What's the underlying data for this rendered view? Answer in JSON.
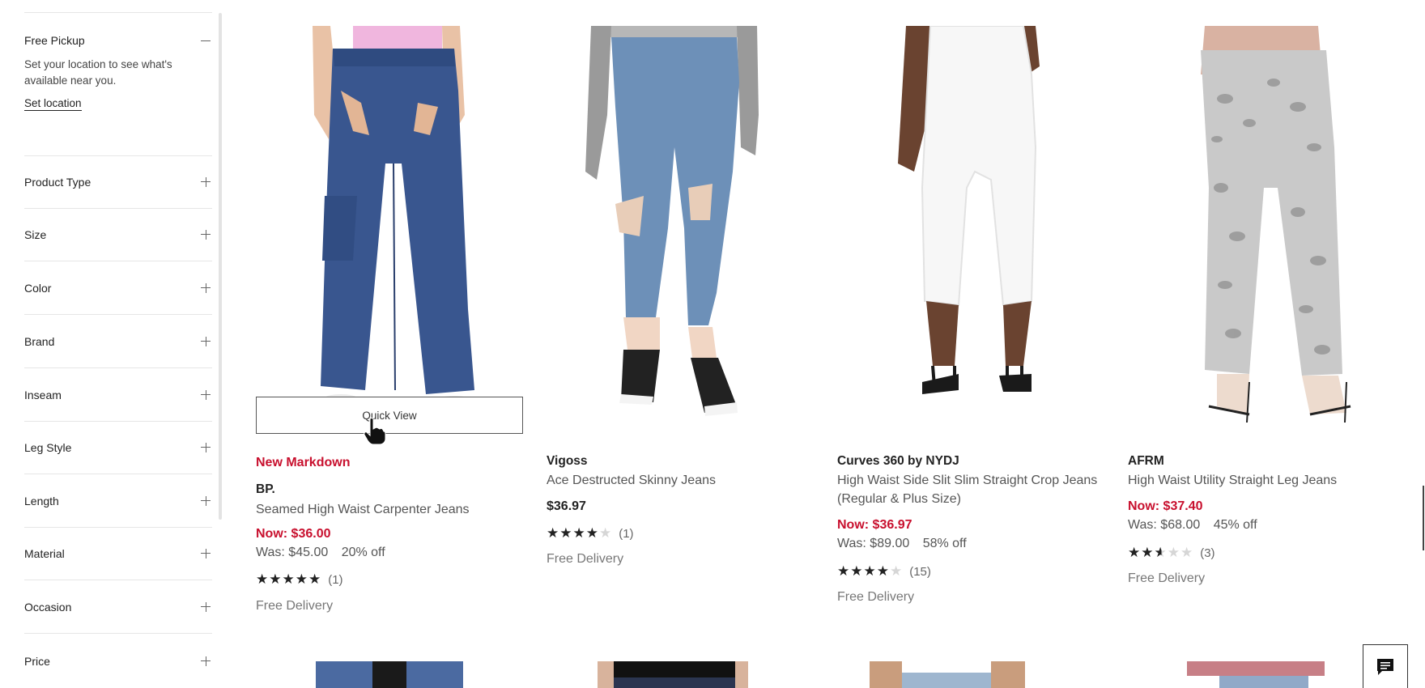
{
  "sidebar": {
    "pickup": {
      "title": "Free Pickup",
      "description": "Set your location to see what's available near you.",
      "link": "Set location"
    },
    "facets": [
      "Product Type",
      "Size",
      "Color",
      "Brand",
      "Inseam",
      "Leg Style",
      "Length",
      "Material",
      "Occasion",
      "Price"
    ]
  },
  "quick_view": "Quick View",
  "products": [
    {
      "badge": "New Markdown",
      "brand": "BP.",
      "name": "Seamed High Waist Carpenter Jeans",
      "name_line2": "",
      "now": "Now: $36.00",
      "was": "Was: $45.00",
      "off": "20% off",
      "rating": 5,
      "half": false,
      "reviews": "(1)",
      "delivery": "Free Delivery",
      "image": "denim-carpenter-jeans"
    },
    {
      "brand": "Vigoss",
      "name": "Ace Destructed Skinny Jeans",
      "price": "$36.97",
      "rating": 4,
      "half": false,
      "reviews": "(1)",
      "delivery": "Free Delivery",
      "image": "light-wash-skinny-jeans"
    },
    {
      "brand": "Curves 360 by NYDJ",
      "name": "High Waist Side Slit Slim Straight Crop Jeans",
      "name_line2": "(Regular & Plus Size)",
      "now": "Now: $36.97",
      "was": "Was: $89.00",
      "off": "58% off",
      "rating": 4,
      "half": true,
      "reviews": "(15)",
      "delivery": "Free Delivery",
      "image": "white-crop-jeans"
    },
    {
      "brand": "AFRM",
      "name": "High Waist Utility Straight Leg Jeans",
      "now": "Now: $37.40",
      "was": "Was: $68.00",
      "off": "45% off",
      "rating": 2,
      "half": true,
      "reviews": "(3)",
      "delivery": "Free Delivery",
      "image": "snake-print-jeans"
    }
  ],
  "colors": {
    "sale_red": "#c8102e",
    "text": "#222222",
    "muted": "#555555",
    "divider": "#e6e6e6"
  },
  "icons": [
    "minus-icon",
    "plus-icon",
    "star-icon",
    "hand-cursor-icon",
    "chat-icon"
  ]
}
